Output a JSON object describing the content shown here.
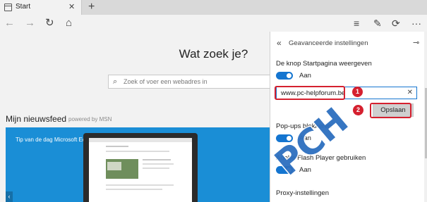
{
  "tab": {
    "title": "Start",
    "close": "✕",
    "new": "+"
  },
  "toolbar": {
    "back": "←",
    "forward": "→",
    "refresh": "↻",
    "home": "⌂",
    "hub": "≡",
    "notes": "✎",
    "share": "⟳",
    "more": "···"
  },
  "search": {
    "heading": "Wat zoek je?",
    "placeholder": "Zoek of voer een webadres in",
    "icon": "search-icon"
  },
  "feed": {
    "title": "Mijn nieuwsfeed",
    "powered_by": "powered by MSN",
    "tip_label": "Tip van de dag Microsoft Edge",
    "arrow": "‹"
  },
  "pane": {
    "back": "«",
    "title": "Geavanceerde instellingen",
    "pin": "⊸",
    "home_label": "De knop Startpagina weergeven",
    "home_toggle": "Aan",
    "url_value": "www.pc-helpforum.be",
    "clear": "✕",
    "save_label": "Opslaan",
    "popups_label": "Pop-ups blokkeren",
    "popups_toggle": "Aan",
    "flash_label": "Adobe Flash Player gebruiken",
    "flash_toggle": "Aan",
    "proxy_label": "Proxy-instellingen"
  },
  "annotations": {
    "badge1": "1",
    "badge2": "2",
    "color": "#d5202f"
  },
  "watermark": {
    "text": "PCH"
  },
  "colors": {
    "accent": "#1475d0",
    "tip_bg": "#1a8ed6"
  }
}
